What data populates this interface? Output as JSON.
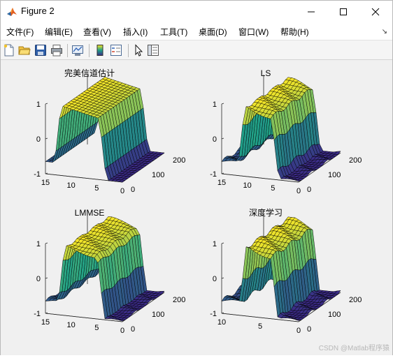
{
  "window": {
    "title": "Figure 2",
    "controls": [
      "minimize",
      "maximize",
      "close"
    ]
  },
  "menu": {
    "items": [
      "文件(F)",
      "编辑(E)",
      "查看(V)",
      "插入(I)",
      "工具(T)",
      "桌面(D)",
      "窗口(W)",
      "帮助(H)"
    ],
    "corner_glyph": "↘"
  },
  "toolbar": {
    "icons": [
      "new-figure-icon",
      "open-file-icon",
      "save-icon",
      "print-icon",
      "link-plot-icon",
      "insert-colorbar-icon",
      "insert-legend-icon",
      "edit-plot-icon",
      "property-inspector-icon"
    ]
  },
  "colors": {
    "surface_low": "#3b2a86",
    "surface_mid": "#1fa188",
    "surface_high": "#f9e625",
    "mesh": "#000000",
    "axis": "#262626"
  },
  "chart_data": [
    {
      "type": "surface3d",
      "title": "完美信道估计",
      "z_ticks": [
        "1",
        "0",
        "-1"
      ],
      "x_ticks": [
        "15",
        "10",
        "5",
        "0"
      ],
      "y_ticks": [
        "0",
        "100",
        "200"
      ],
      "zlim": [
        -1,
        1
      ],
      "xlim": [
        0,
        15
      ],
      "ylim": [
        0,
        200
      ],
      "colormap": "parula"
    },
    {
      "type": "surface3d",
      "title": "LS",
      "z_ticks": [
        "1",
        "0",
        "-1"
      ],
      "x_ticks": [
        "15",
        "10",
        "5",
        "0"
      ],
      "y_ticks": [
        "0",
        "100",
        "200"
      ],
      "zlim": [
        -1,
        1
      ],
      "xlim": [
        0,
        15
      ],
      "ylim": [
        0,
        200
      ],
      "colormap": "parula"
    },
    {
      "type": "surface3d",
      "title": "LMMSE",
      "z_ticks": [
        "1",
        "0",
        "-1"
      ],
      "x_ticks": [
        "15",
        "10",
        "5",
        "0"
      ],
      "y_ticks": [
        "0",
        "100",
        "200"
      ],
      "zlim": [
        -1,
        1
      ],
      "xlim": [
        0,
        15
      ],
      "ylim": [
        0,
        200
      ],
      "colormap": "parula"
    },
    {
      "type": "surface3d",
      "title": "深度学习",
      "z_ticks": [
        "1",
        "0",
        "-1"
      ],
      "x_ticks": [
        "10",
        "5",
        "0"
      ],
      "y_ticks": [
        "0",
        "100",
        "200"
      ],
      "zlim": [
        -1,
        1
      ],
      "xlim": [
        0,
        12
      ],
      "ylim": [
        0,
        200
      ],
      "colormap": "parula"
    }
  ],
  "watermark": "CSDN @Matlab程序猿"
}
